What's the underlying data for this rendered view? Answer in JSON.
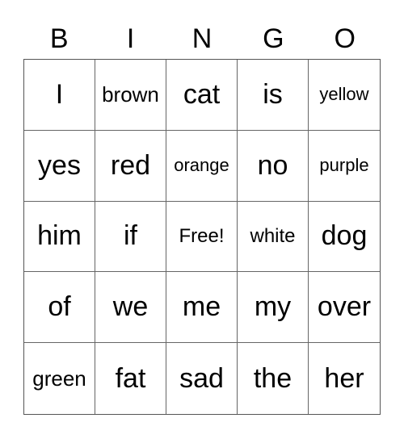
{
  "header": [
    "B",
    "I",
    "N",
    "G",
    "O"
  ],
  "cells": [
    [
      "I",
      "brown",
      "cat",
      "is",
      "yellow"
    ],
    [
      "yes",
      "red",
      "orange",
      "no",
      "purple"
    ],
    [
      "him",
      "if",
      "Free!",
      "white",
      "dog"
    ],
    [
      "of",
      "we",
      "me",
      "my",
      "over"
    ],
    [
      "green",
      "fat",
      "sad",
      "the",
      "her"
    ]
  ]
}
